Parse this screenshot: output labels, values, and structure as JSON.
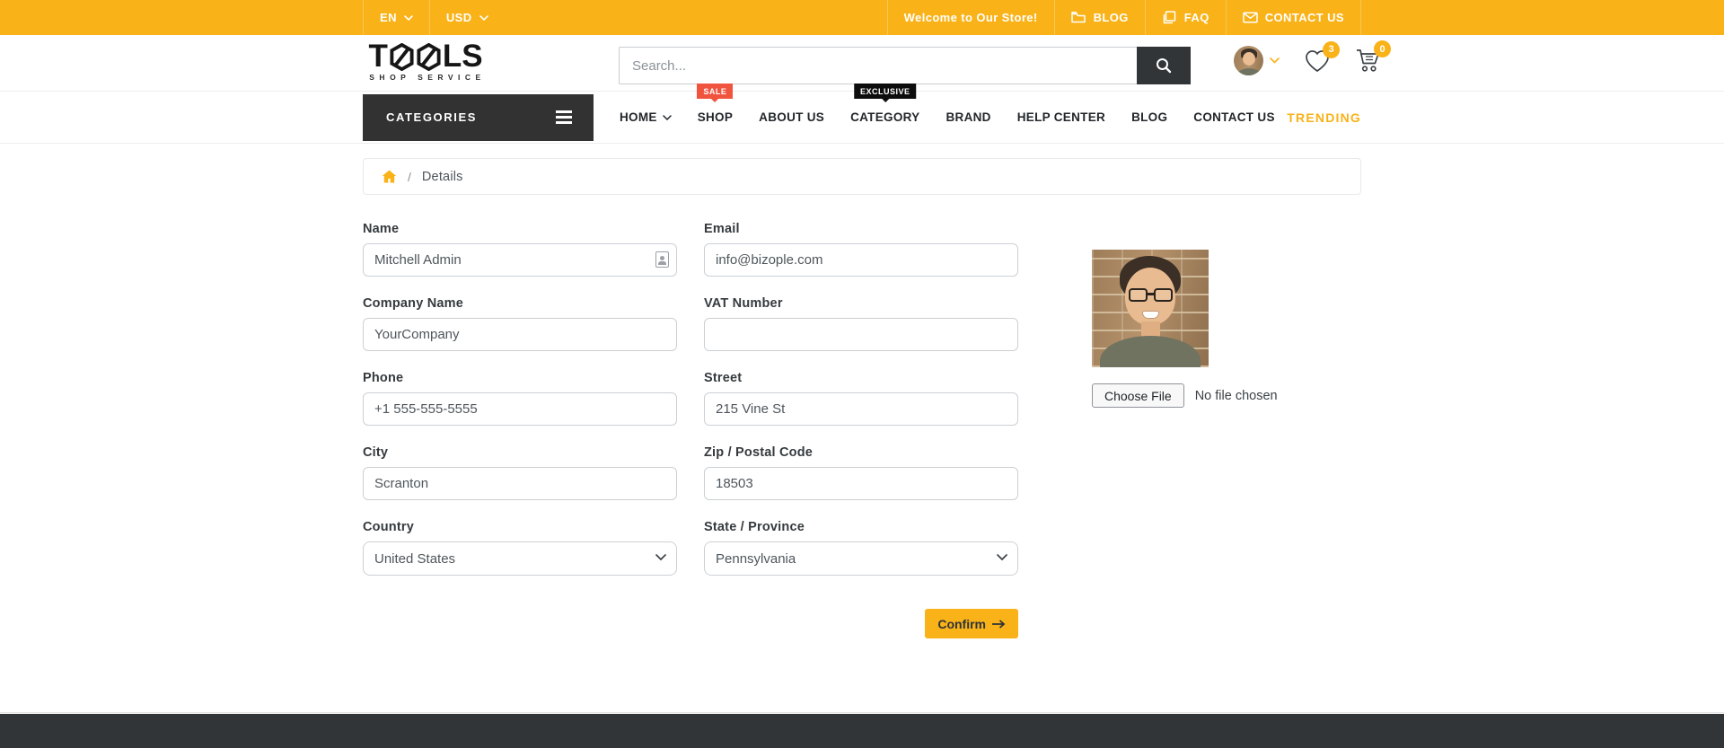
{
  "colors": {
    "accent": "#f9b217",
    "sale_red": "#f0543f",
    "dark": "#313538"
  },
  "topbar": {
    "language": "EN",
    "currency": "USD",
    "welcome": "Welcome to Our Store!",
    "links": [
      {
        "label": "BLOG"
      },
      {
        "label": "FAQ"
      },
      {
        "label": "CONTACT US"
      }
    ]
  },
  "header": {
    "logo_text_start": "T",
    "logo_text_end": "LS",
    "logo_subtitle": "SHOP SERVICE",
    "search_placeholder": "Search...",
    "wishlist_count": "3",
    "cart_count": "0"
  },
  "nav": {
    "categories_label": "CATEGORIES",
    "items": [
      {
        "label": "HOME"
      },
      {
        "label": "SHOP",
        "badge": "SALE"
      },
      {
        "label": "ABOUT US"
      },
      {
        "label": "CATEGORY",
        "badge": "EXCLUSIVE"
      },
      {
        "label": "BRAND"
      },
      {
        "label": "HELP CENTER"
      },
      {
        "label": "BLOG"
      },
      {
        "label": "CONTACT US"
      }
    ],
    "trending_label": "TRENDING"
  },
  "breadcrumb": {
    "separator": "/",
    "current": "Details"
  },
  "form": {
    "name": {
      "label": "Name",
      "value": "Mitchell Admin"
    },
    "email": {
      "label": "Email",
      "value": "info@bizople.com"
    },
    "company": {
      "label": "Company Name",
      "value": "YourCompany"
    },
    "vat": {
      "label": "VAT Number",
      "value": ""
    },
    "phone": {
      "label": "Phone",
      "value": "+1 555-555-5555"
    },
    "street": {
      "label": "Street",
      "value": "215 Vine St"
    },
    "city": {
      "label": "City",
      "value": "Scranton"
    },
    "zip": {
      "label": "Zip / Postal Code",
      "value": "18503"
    },
    "country": {
      "label": "Country",
      "value": "United States"
    },
    "state": {
      "label": "State / Province",
      "value": "Pennsylvania"
    },
    "confirm_label": "Confirm",
    "file_button_label": "Choose File",
    "file_status": "No file chosen"
  }
}
